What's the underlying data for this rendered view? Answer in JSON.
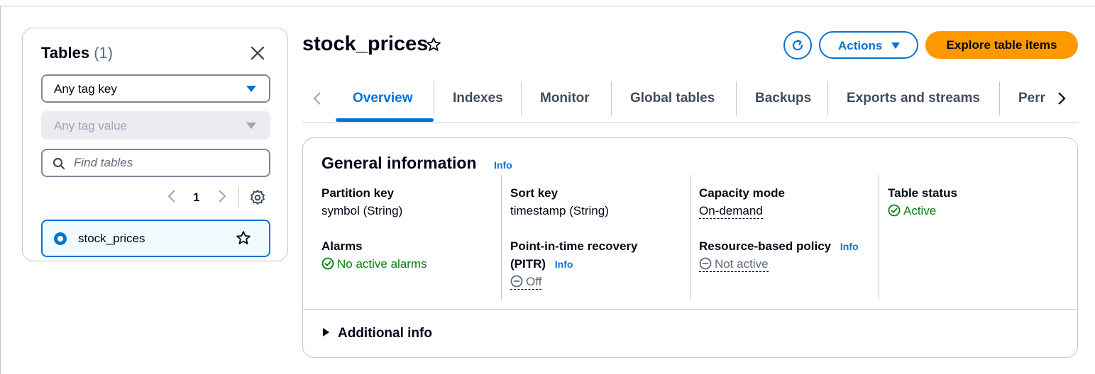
{
  "sidebar": {
    "title": "Tables",
    "count": "(1)",
    "tag_key_select": "Any tag key",
    "tag_value_select": "Any tag value",
    "search_placeholder": "Find tables",
    "page_number": "1",
    "tables": [
      {
        "name": "stock_prices",
        "selected": true
      }
    ]
  },
  "header": {
    "title": "stock_prices",
    "actions_label": "Actions",
    "explore_label": "Explore table items"
  },
  "tabs": [
    {
      "label": "Overview",
      "active": true
    },
    {
      "label": "Indexes"
    },
    {
      "label": "Monitor"
    },
    {
      "label": "Global tables"
    },
    {
      "label": "Backups"
    },
    {
      "label": "Exports and streams"
    },
    {
      "label": "Perr"
    }
  ],
  "general": {
    "title": "General information",
    "info": "Info",
    "partition_key_label": "Partition key",
    "partition_key_value": "symbol (String)",
    "alarms_label": "Alarms",
    "alarms_value": "No active alarms",
    "sort_key_label": "Sort key",
    "sort_key_value": "timestamp (String)",
    "pitr_label_1": "Point-in-time recovery",
    "pitr_label_2": "(PITR)",
    "pitr_info": "Info",
    "pitr_value": "Off",
    "capacity_label": "Capacity mode",
    "capacity_value": "On-demand",
    "policy_label": "Resource-based policy",
    "policy_info": "Info",
    "policy_value": "Not active",
    "status_label": "Table status",
    "status_value": "Active",
    "additional_info": "Additional info"
  },
  "colors": {
    "accent": "#0972d3",
    "primary_button": "#ff9900",
    "success": "#037f0c",
    "muted": "#5f6b7a"
  }
}
